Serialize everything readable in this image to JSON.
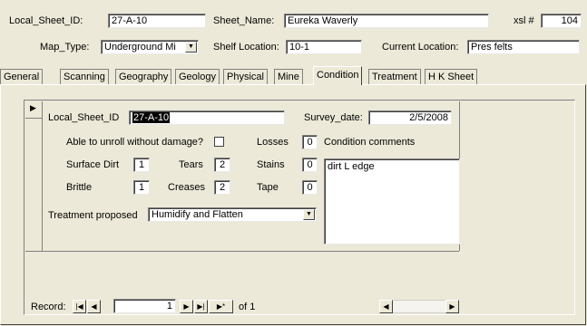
{
  "header": {
    "local_sheet_id_label": "Local_Sheet_ID:",
    "local_sheet_id_value": "27-A-10",
    "sheet_name_label": "Sheet_Name:",
    "sheet_name_value": "Eureka Waverly",
    "xsl_label": "xsl #",
    "xsl_value": "104",
    "map_type_label": "Map_Type:",
    "map_type_value": "Underground Mi",
    "shelf_location_label": "Shelf Location:",
    "shelf_location_value": "10-1",
    "current_location_label": "Current Location:",
    "current_location_value": "Pres felts"
  },
  "tabs": [
    {
      "label": "General"
    },
    {
      "label": "Scanning"
    },
    {
      "label": "Geography"
    },
    {
      "label": "Geology"
    },
    {
      "label": "Physical"
    },
    {
      "label": "Mine"
    },
    {
      "label": "Condition",
      "active": true
    },
    {
      "label": "Treatment"
    },
    {
      "label": "H K Sheet"
    }
  ],
  "condition": {
    "record_selector": "▶",
    "local_sheet_id_label": "Local_Sheet_ID",
    "local_sheet_id_value": "27-A-10",
    "survey_date_label": "Survey_date:",
    "survey_date_value": "2/5/2008",
    "unroll_label": "Able to unroll without damage?",
    "unroll_checked": false,
    "losses_label": "Losses",
    "losses_value": "0",
    "condition_comments_label": "Condition comments",
    "surface_dirt_label": "Surface Dirt",
    "surface_dirt_value": "1",
    "tears_label": "Tears",
    "tears_value": "2",
    "stains_label": "Stains",
    "stains_value": "0",
    "brittle_label": "Brittle",
    "brittle_value": "1",
    "creases_label": "Creases",
    "creases_value": "2",
    "tape_label": "Tape",
    "tape_value": "0",
    "comments_value": "dirt L edge",
    "treatment_proposed_label": "Treatment proposed",
    "treatment_proposed_value": "Humidify and Flatten"
  },
  "record_nav": {
    "label": "Record:",
    "current": "1",
    "of_label": "of 1",
    "first_icon": "first-record-icon",
    "prev_icon": "prev-record-icon",
    "next_icon": "next-record-icon",
    "last_icon": "last-record-icon",
    "new_icon": "new-record-icon"
  }
}
